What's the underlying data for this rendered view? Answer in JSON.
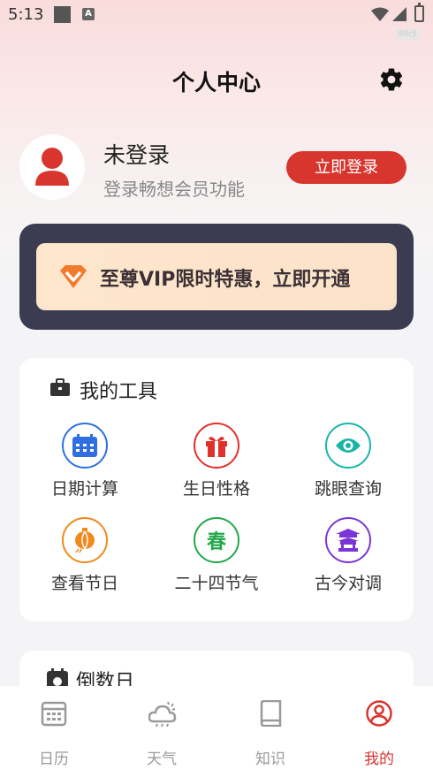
{
  "status_bar": {
    "time": "5:13",
    "a_icon": "A",
    "badge": "80r5"
  },
  "header": {
    "title": "个人中心",
    "settings_icon": "gear-icon"
  },
  "profile": {
    "status": "未登录",
    "subtitle": "登录畅想会员功能",
    "login_button": "立即登录"
  },
  "vip": {
    "text": "至尊VIP限时特惠，立即开通",
    "icon": "vip-badge-icon"
  },
  "tools": {
    "title": "我的工具",
    "items": [
      {
        "label": "日期计算",
        "icon": "calendar-icon",
        "color": "#2f6fe0"
      },
      {
        "label": "生日性格",
        "icon": "gift-icon",
        "color": "#e0322c"
      },
      {
        "label": "跳眼查询",
        "icon": "eye-icon",
        "color": "#19b5a8"
      },
      {
        "label": "查看节日",
        "icon": "lantern-icon",
        "color": "#f08a1c",
        "glyph": ""
      },
      {
        "label": "二十四节气",
        "icon": "spring-icon",
        "color": "#22a84a",
        "glyph": "春"
      },
      {
        "label": "古今对调",
        "icon": "temple-icon",
        "color": "#7a35d6"
      }
    ]
  },
  "countdown": {
    "title": "倒数日"
  },
  "bottom_nav": [
    {
      "label": "日历",
      "icon": "calendar-grid-icon",
      "active": false
    },
    {
      "label": "天气",
      "icon": "weather-icon",
      "active": false
    },
    {
      "label": "知识",
      "icon": "book-icon",
      "active": false
    },
    {
      "label": "我的",
      "icon": "user-icon",
      "active": true
    }
  ],
  "colors": {
    "accent": "#d9352f",
    "vip_card": "#3b3b52"
  }
}
